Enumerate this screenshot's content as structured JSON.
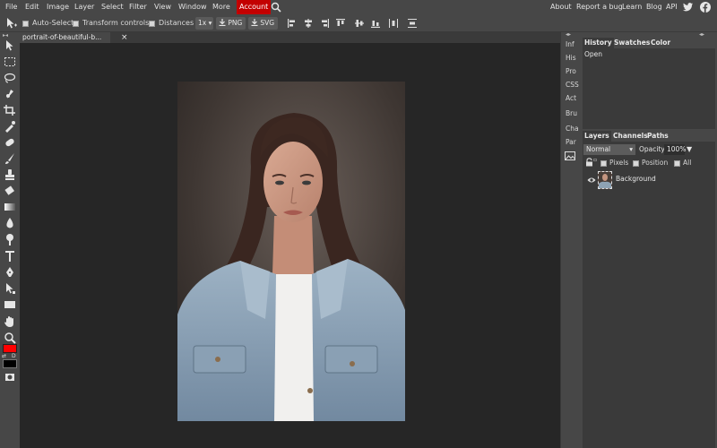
{
  "menubar": {
    "items": [
      "File",
      "Edit",
      "Image",
      "Layer",
      "Select",
      "Filter",
      "View",
      "Window",
      "More",
      "Account"
    ],
    "right_links": [
      "About",
      "Report a bug",
      "Learn",
      "Blog",
      "API"
    ]
  },
  "options": {
    "auto_select": "Auto-Select",
    "transform_controls": "Transform controls",
    "distances": "Distances",
    "zoom": "1x",
    "png": "PNG",
    "svg": "SVG"
  },
  "document": {
    "tab_title": "portrait-of-beautiful-b...",
    "close": "×"
  },
  "mini_panels": [
    "Inf",
    "His",
    "Pro",
    "CSS",
    "Act",
    "Bru",
    "Cha",
    "Par"
  ],
  "history_panel": {
    "tabs": [
      "History",
      "Swatches",
      "Color"
    ],
    "items": [
      "Open"
    ]
  },
  "layers_panel": {
    "tabs": [
      "Layers",
      "Channels",
      "Paths"
    ],
    "blend_mode": "Normal",
    "opacity_label": "Opacity:",
    "opacity_value": "100%",
    "lock_labels": [
      "Pixels",
      "Position",
      "All"
    ],
    "layers": [
      {
        "name": "Background"
      }
    ]
  },
  "colors": {
    "foreground": "#ff0000",
    "background": "#000000",
    "accent": "#c30000"
  }
}
